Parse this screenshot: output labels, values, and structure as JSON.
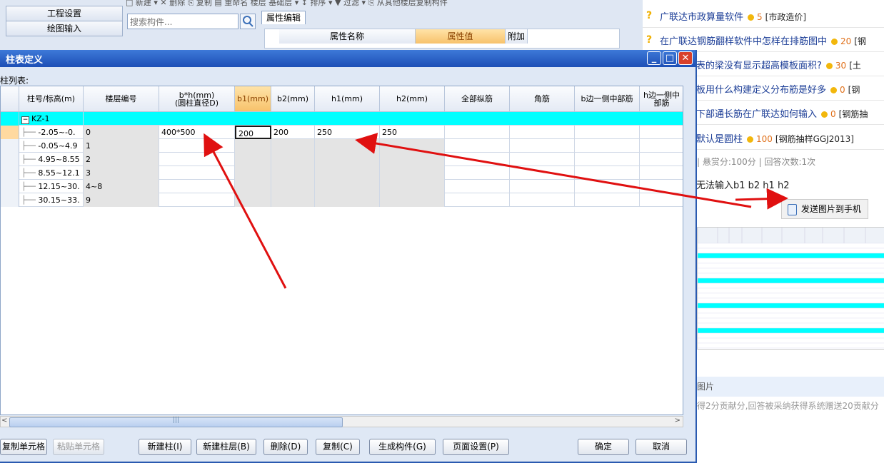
{
  "bg_app": {
    "toolbar_text": "□ 新建 ▾  ✕ 删除  ⎘ 复制  ▤ 重命名  楼层  基础层  ▾  ↕ 排序 ▾  ▼ 过滤 ▾  ⎘ 从其他楼层复制构件",
    "nav": [
      "工程设置",
      "绘图输入"
    ],
    "search_placeholder": "搜索构件...",
    "prop_tab": "属性编辑",
    "prop_headers": [
      "属性名称",
      "属性值",
      "附加"
    ]
  },
  "dialog": {
    "title": "柱表定义",
    "list_label": "柱列表:",
    "headers": [
      "柱号/标高(m)",
      "楼层编号",
      "b*h(mm)\n(圆柱直径D)",
      "b1(mm)",
      "b2(mm)",
      "h1(mm)",
      "h2(mm)",
      "全部纵筋",
      "角筋",
      "b边一侧中部筋",
      "h边一侧中部筋"
    ],
    "group": {
      "toggle": "−",
      "name": "KZ-1"
    },
    "rows": [
      {
        "elev": "-2.05~-0.",
        "floor": "0",
        "bh": "400*500",
        "b1": "200",
        "b2": "200",
        "h1": "250",
        "h2": "250"
      },
      {
        "elev": "-0.05~4.9",
        "floor": "1",
        "bh": "",
        "b1": "",
        "b2": "",
        "h1": "",
        "h2": ""
      },
      {
        "elev": "4.95~8.55",
        "floor": "2",
        "bh": "",
        "b1": "",
        "b2": "",
        "h1": "",
        "h2": ""
      },
      {
        "elev": "8.55~12.1",
        "floor": "3",
        "bh": "",
        "b1": "",
        "b2": "",
        "h1": "",
        "h2": ""
      },
      {
        "elev": "12.15~30.",
        "floor": "4~8",
        "bh": "",
        "b1": "",
        "b2": "",
        "h1": "",
        "h2": ""
      },
      {
        "elev": "30.15~33.",
        "floor": "9",
        "bh": "",
        "b1": "",
        "b2": "",
        "h1": "",
        "h2": ""
      }
    ],
    "buttons": {
      "copy_cell": "复制单元格",
      "paste_cell": "粘贴单元格",
      "new_column": "新建柱(I)",
      "new_layer": "新建柱层(B)",
      "delete": "删除(D)",
      "copy": "复制(C)",
      "generate": "生成构件(G)",
      "page_setup": "页面设置(P)",
      "ok": "确定",
      "cancel": "取消"
    },
    "scroll_mark": "|||"
  },
  "right": {
    "questions": [
      {
        "text": "广联达市政算量软件",
        "points": "5",
        "tag": "[市政造价]"
      },
      {
        "text": "在广联达钢筋翻样软件中怎样在排筋图中",
        "points": "20",
        "tag": "[钢"
      },
      {
        "text": "表的梁没有显示超高模板面积?",
        "points": "30",
        "tag": "[土"
      },
      {
        "text": "板用什么构建定义分布筋是好多",
        "points": "0",
        "tag": "[钢"
      },
      {
        "text": "下部通长筋在广联达如何输入",
        "points": "0",
        "tag": "[钢筋抽"
      },
      {
        "text": "默认是圆柱",
        "points": "100",
        "tag": "[钢筋抽样GGJ2013]"
      }
    ],
    "meta": "|    悬赏分:100分    |    回答次数:1次",
    "question_text": "无法输入b1 b2 h1 h2",
    "send_button": "发送图片到手机",
    "pic_label": "图片",
    "footer_note": "得2分贡献分,回答被采纳获得系统赠送20贡献分"
  },
  "colors": {
    "title_blue": "#1d4fb6",
    "group_cyan": "#00ffff",
    "selected_header": "#f7c26b",
    "arrow_red": "#e01010",
    "link_blue": "#1a3c96"
  }
}
